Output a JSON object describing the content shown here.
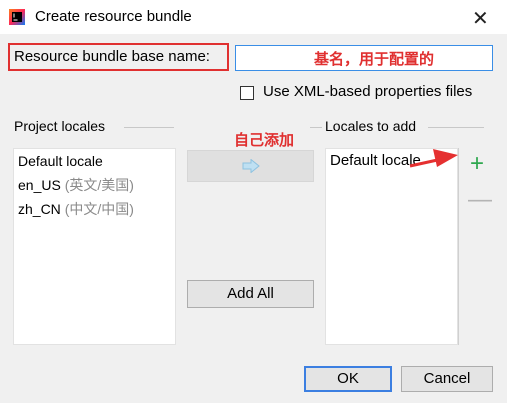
{
  "window": {
    "title": "Create resource bundle",
    "close_glyph": "✕"
  },
  "form": {
    "base_name_label": "Resource bundle base name:",
    "base_name_value": "",
    "annotation_base": "基名，用于配置的",
    "xml_checkbox_label": "Use XML-based properties files",
    "xml_checked": false
  },
  "project_locales": {
    "title": "Project locales",
    "items": [
      {
        "code": "Default locale",
        "hint": ""
      },
      {
        "code": "en_US",
        "hint": "(英文/美国)"
      },
      {
        "code": "zh_CN",
        "hint": "(中文/中国)"
      }
    ]
  },
  "middle": {
    "annotation_add": "自己添加",
    "move_icon": "right-arrow-icon",
    "add_all_label": "Add All"
  },
  "locales_to_add": {
    "title": "Locales to add",
    "items": [
      {
        "code": "Default locale"
      }
    ],
    "add_glyph": "+",
    "remove_glyph": "—"
  },
  "buttons": {
    "ok_label": "OK",
    "cancel_label": "Cancel"
  },
  "colors": {
    "annotation_red": "#e03030",
    "focus_blue": "#3a8ee6",
    "add_green": "#2fa84f"
  }
}
